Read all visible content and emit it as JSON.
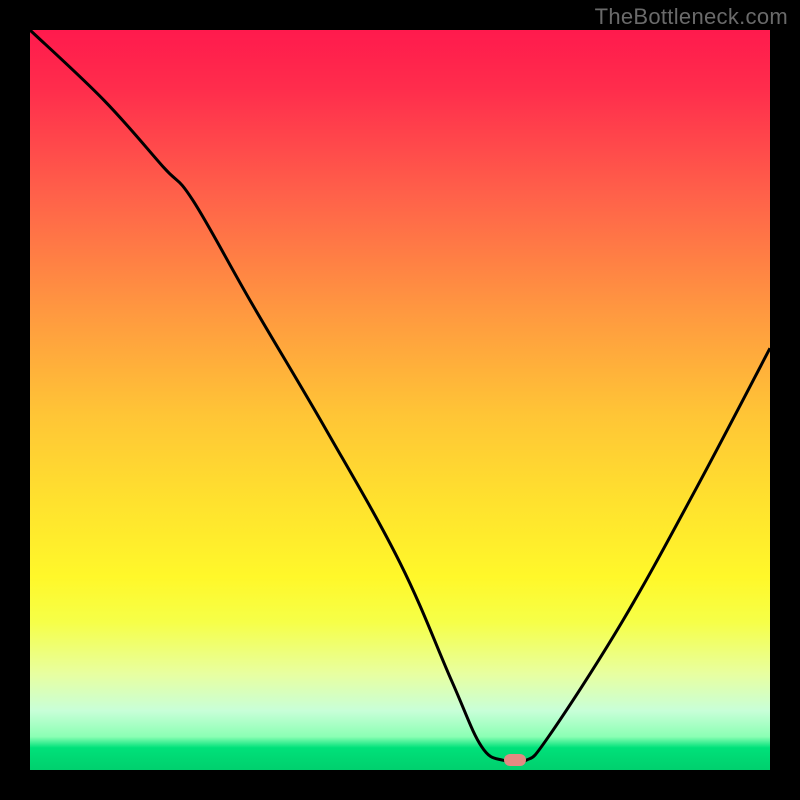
{
  "watermark": "TheBottleneck.com",
  "chart_data": {
    "type": "line",
    "title": "",
    "xlabel": "",
    "ylabel": "",
    "xlim": [
      0,
      100
    ],
    "ylim": [
      0,
      100
    ],
    "grid": false,
    "legend": false,
    "background_gradient": {
      "top": "#ff1a4d",
      "mid": "#ffe22e",
      "bottom": "#00d06e"
    },
    "series": [
      {
        "name": "bottleneck-curve",
        "color": "#000000",
        "x": [
          0,
          10,
          18,
          22,
          30,
          40,
          50,
          57,
          61,
          64,
          67,
          70,
          80,
          90,
          100
        ],
        "values": [
          100,
          90.5,
          81.5,
          77,
          63,
          46,
          28,
          12,
          3.2,
          1.3,
          1.3,
          4.4,
          20,
          38,
          57
        ]
      }
    ],
    "marker": {
      "x": 65.5,
      "y": 1.3,
      "color": "#e38a82"
    }
  }
}
